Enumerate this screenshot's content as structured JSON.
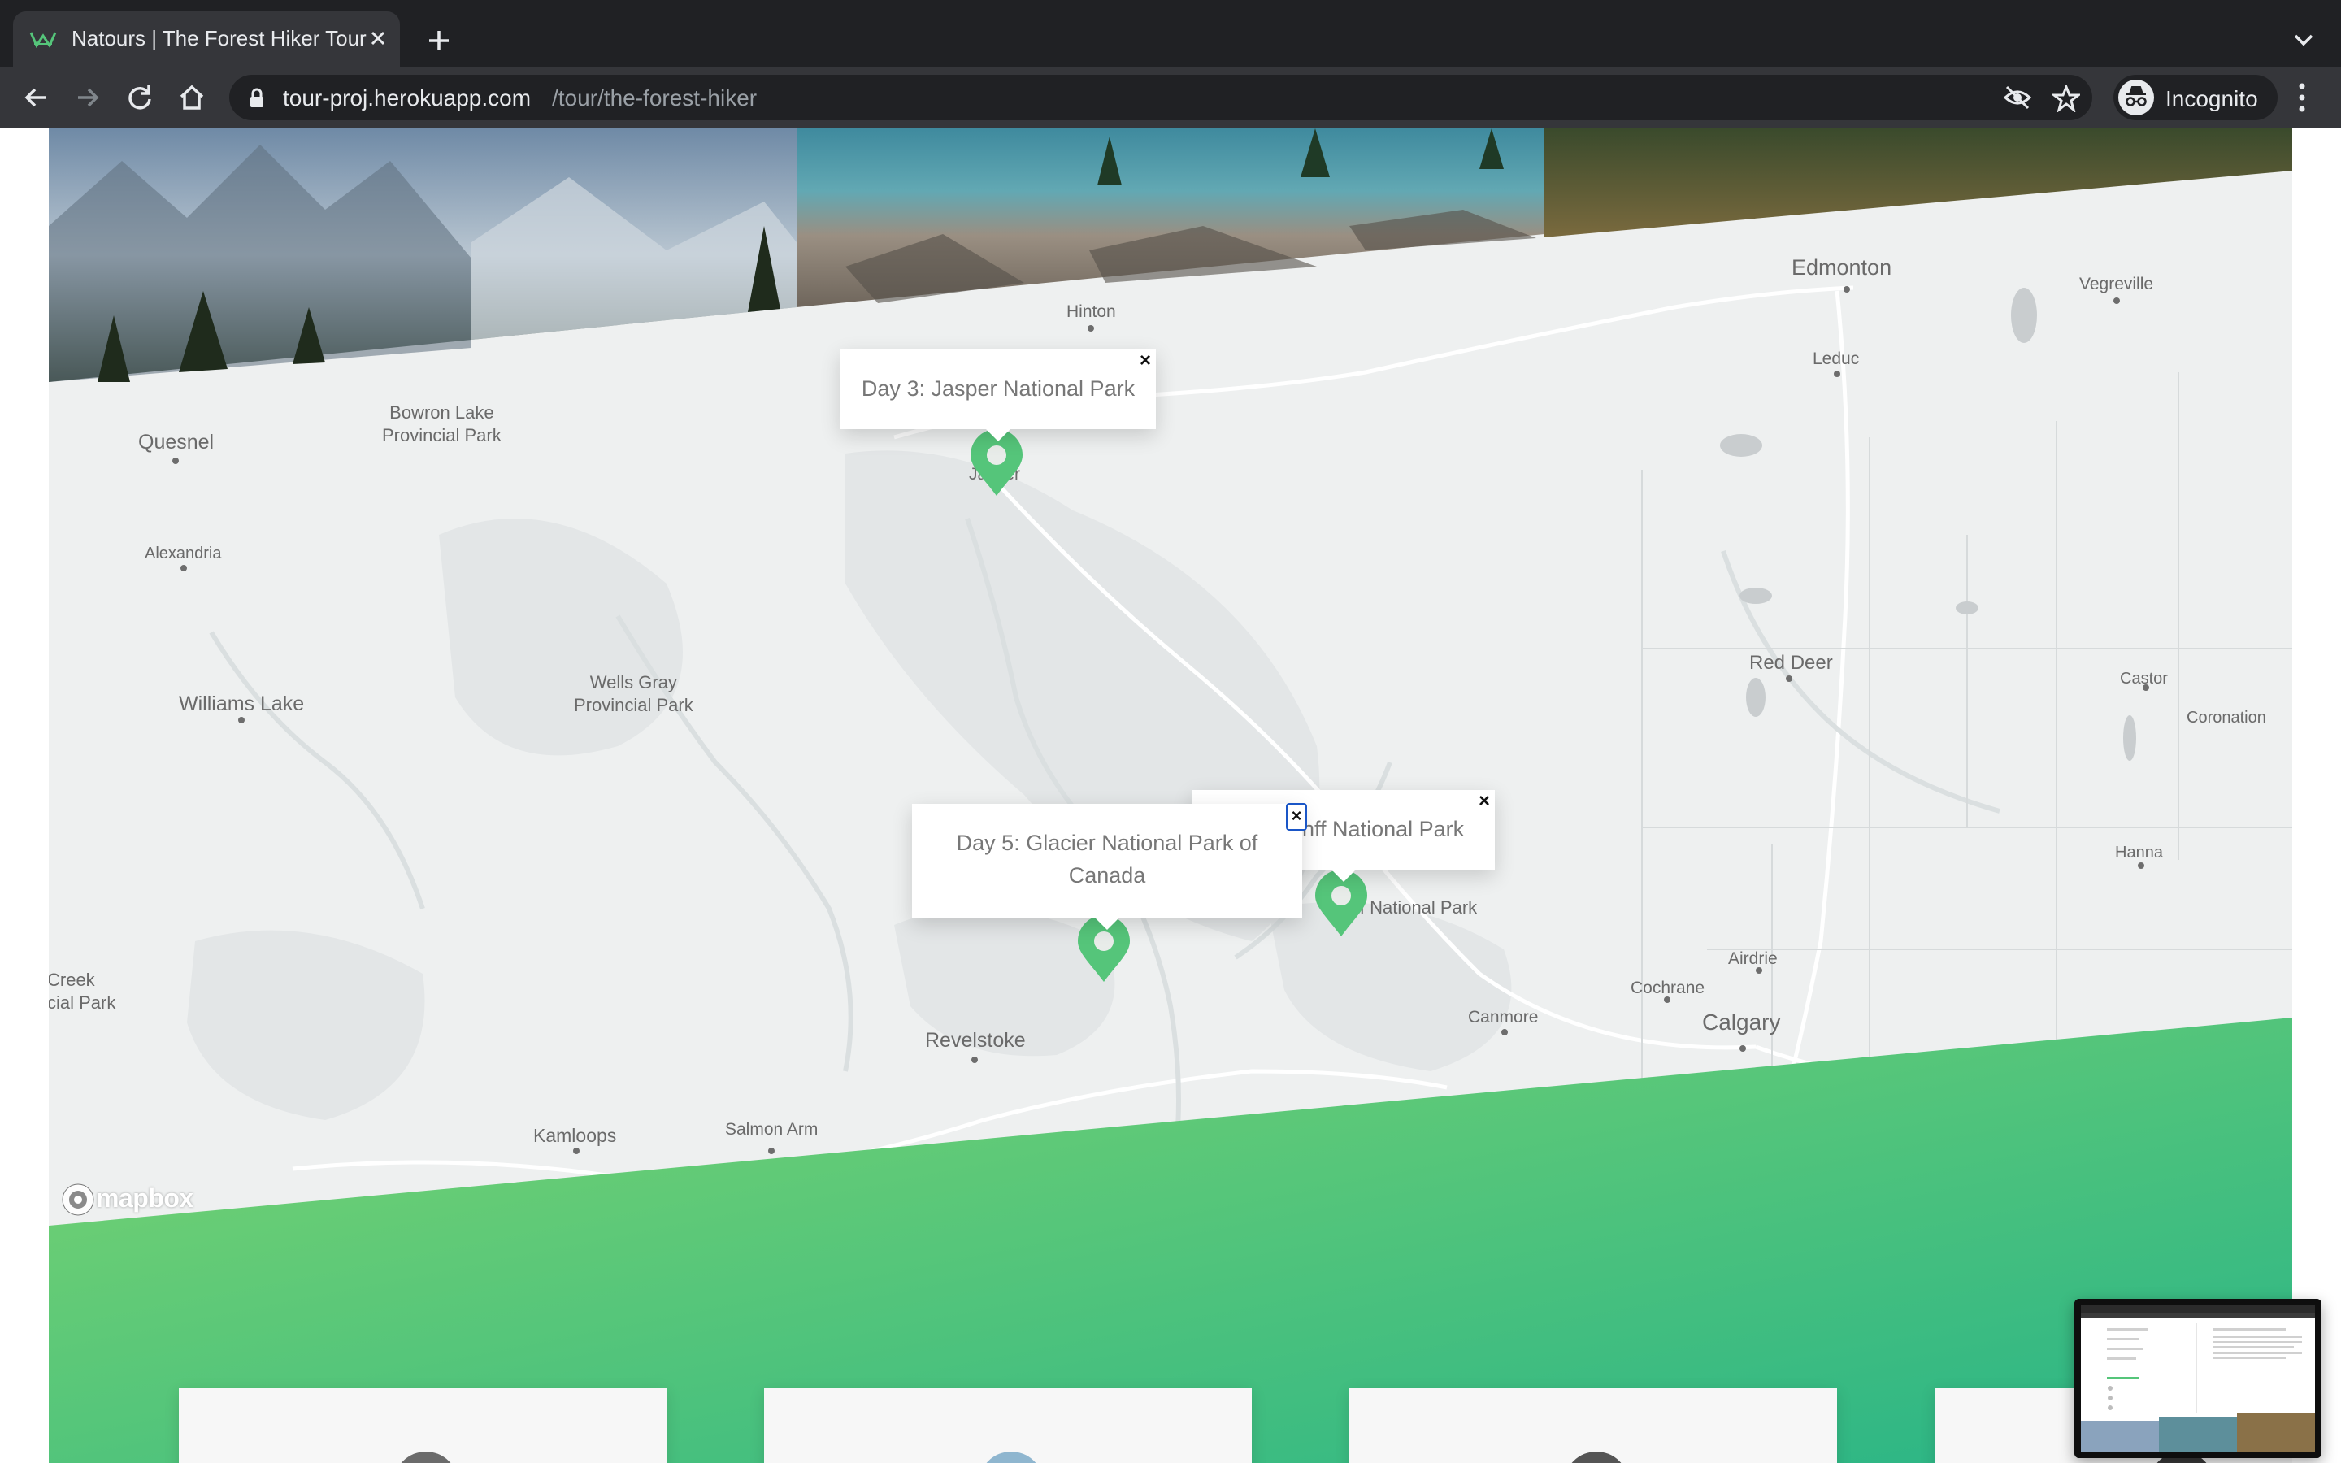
{
  "browser": {
    "tab_title": "Natours | The Forest Hiker Tour",
    "url_host": "tour-proj.herokuapp.com",
    "url_path": "/tour/the-forest-hiker",
    "profile_label": "Incognito",
    "icons": [
      "back-icon",
      "forward-icon",
      "reload-icon",
      "home-icon",
      "lock-icon",
      "eye-off-icon",
      "star-icon",
      "incognito-icon",
      "more-vert-icon",
      "close-icon",
      "plus-icon",
      "chevron-down-icon"
    ]
  },
  "map": {
    "attribution": "mapbox",
    "places": [
      "Edmonton",
      "Vegreville",
      "Hinton",
      "Leduc",
      "Bowron Lake\nProvincial Park",
      "Quesnel",
      "Alexandria",
      "Wells Gray\nProvincial Park",
      "Williams Lake",
      "Red Deer",
      "Castor",
      "Coronation",
      "Hanna",
      "Airdrie",
      "Cochrane",
      "Calgary",
      "Canmore",
      "Revelstoke",
      "Kamloops",
      "Salmon Arm",
      "Creek\ncial Park",
      "Jasper",
      "Banff National Park"
    ],
    "popups": {
      "jasper": "Day 3: Jasper National Park",
      "banff": "anff National Park",
      "glacier": "Day 5: Glacier National Park of Canada"
    },
    "close_glyph": "×",
    "colors": {
      "marker": "#55c57a",
      "gradient_start": "#7dd56f",
      "gradient_end": "#28b487",
      "map_background": "#eef0f0"
    }
  }
}
